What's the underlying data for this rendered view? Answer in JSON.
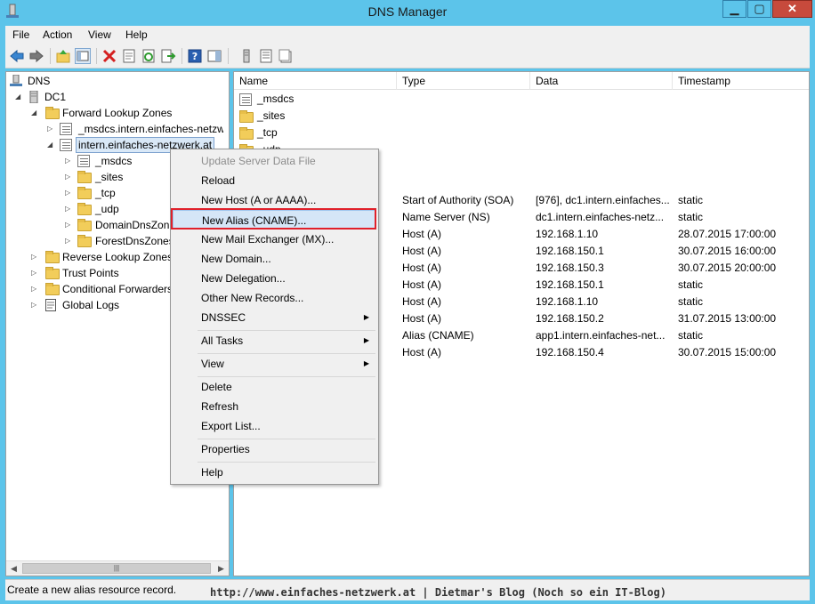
{
  "window": {
    "title": "DNS Manager"
  },
  "menubar": {
    "items": [
      "File",
      "Action",
      "View",
      "Help"
    ]
  },
  "toolbar": {
    "icons": [
      "back-arrow-icon",
      "forward-arrow-icon",
      "up-folder-icon",
      "show-console-tree-icon",
      "delete-icon",
      "properties-icon",
      "refresh-icon",
      "export-list-icon",
      "help-icon",
      "show-action-pane-icon",
      "server-icon",
      "record-list-icon",
      "zone-icon"
    ]
  },
  "tree": {
    "root": "DNS",
    "server": "DC1",
    "forward_zones": "Forward Lookup Zones",
    "msdcs_zone": "_msdcs.intern.einfaches-netzwer",
    "selected_zone": "intern.einfaches-netzwerk.at",
    "children": [
      "_msdcs",
      "_sites",
      "_tcp",
      "_udp",
      "DomainDnsZon",
      "ForestDnsZones"
    ],
    "reverse_zones": "Reverse Lookup Zones",
    "trust_points": "Trust Points",
    "conditional_forwarders": "Conditional Forwarders",
    "global_logs": "Global Logs"
  },
  "list": {
    "columns": [
      "Name",
      "Type",
      "Data",
      "Timestamp"
    ],
    "folders": [
      "_msdcs",
      "_sites",
      "_tcp",
      "_udp"
    ],
    "records": [
      {
        "type": "Start of Authority (SOA)",
        "data": "[976], dc1.intern.einfaches...",
        "timestamp": "static"
      },
      {
        "type": "Name Server (NS)",
        "data": "dc1.intern.einfaches-netz...",
        "timestamp": "static"
      },
      {
        "type": "Host (A)",
        "data": "192.168.1.10",
        "timestamp": "28.07.2015 17:00:00"
      },
      {
        "type": "Host (A)",
        "data": "192.168.150.1",
        "timestamp": "30.07.2015 16:00:00"
      },
      {
        "type": "Host (A)",
        "data": "192.168.150.3",
        "timestamp": "30.07.2015 20:00:00"
      },
      {
        "type": "Host (A)",
        "data": "192.168.150.1",
        "timestamp": "static"
      },
      {
        "type": "Host (A)",
        "data": "192.168.1.10",
        "timestamp": "static"
      },
      {
        "type": "Host (A)",
        "data": "192.168.150.2",
        "timestamp": "31.07.2015 13:00:00"
      },
      {
        "type": "Alias (CNAME)",
        "data": "app1.intern.einfaches-net...",
        "timestamp": "static"
      },
      {
        "type": "Host (A)",
        "data": "192.168.150.4",
        "timestamp": "30.07.2015 15:00:00"
      }
    ]
  },
  "context_menu": {
    "update_server_data_file": "Update Server Data File",
    "reload": "Reload",
    "new_host": "New Host (A or AAAA)...",
    "new_alias": "New Alias (CNAME)...",
    "new_mail_exchanger": "New Mail Exchanger (MX)...",
    "new_domain": "New Domain...",
    "new_delegation": "New Delegation...",
    "other_new_records": "Other New Records...",
    "dnssec": "DNSSEC",
    "all_tasks": "All Tasks",
    "view": "View",
    "delete": "Delete",
    "refresh": "Refresh",
    "export_list": "Export List...",
    "properties": "Properties",
    "help": "Help"
  },
  "status": {
    "text": "Create a new alias resource record."
  },
  "watermark": "http://www.einfaches-netzwerk.at | Dietmar's Blog (Noch so ein IT-Blog)",
  "colors": {
    "title_bar": "#5cc4ea",
    "close_button": "#c74a3c",
    "highlight_border": "#e0202a",
    "selection": "#d5e6f7"
  }
}
